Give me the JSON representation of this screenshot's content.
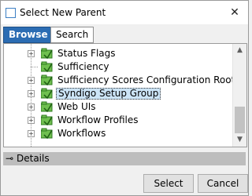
{
  "window": {
    "title": "Select New Parent"
  },
  "tabs": [
    "Browse",
    "Search"
  ],
  "tree": {
    "items": [
      {
        "label": "Status Flags",
        "expandable": true
      },
      {
        "label": "Sufficiency",
        "expandable": false
      },
      {
        "label": "Sufficiency Scores Configuration Root",
        "expandable": true
      },
      {
        "label": "Syndigo Setup Group",
        "expandable": true,
        "selected": true
      },
      {
        "label": "Web UIs",
        "expandable": true
      },
      {
        "label": "Workflow Profiles",
        "expandable": true
      },
      {
        "label": "Workflows",
        "expandable": true
      }
    ]
  },
  "details": {
    "label": "Details"
  },
  "buttons": {
    "select": "Select",
    "cancel": "Cancel"
  },
  "colors": {
    "tab_active": "#2b6cb3",
    "selection": "#cce4f7",
    "folder_green": "#3f9d2f",
    "details_bar": "#bdbdbd"
  },
  "icons": {
    "close": "close-icon",
    "folder": "folder-icon",
    "details": "key-icon"
  }
}
